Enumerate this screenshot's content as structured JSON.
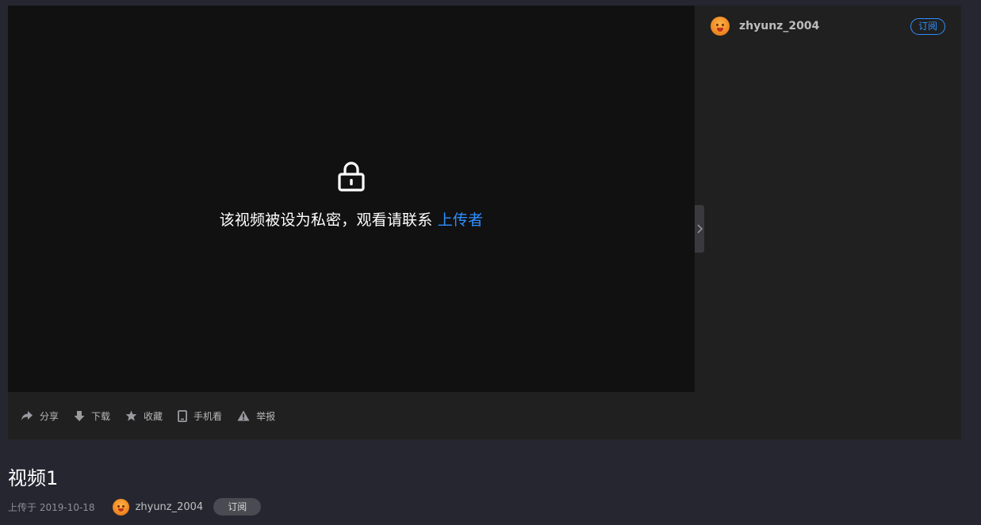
{
  "player": {
    "message": "该视频被设为私密，观看请联系",
    "link_text": "上传者"
  },
  "sidebar": {
    "username": "zhyunz_2004",
    "subscribe_label": "订阅"
  },
  "actions": [
    {
      "label": "分享",
      "icon": "share-icon"
    },
    {
      "label": "下载",
      "icon": "download-icon"
    },
    {
      "label": "收藏",
      "icon": "star-icon"
    },
    {
      "label": "手机看",
      "icon": "mobile-icon"
    },
    {
      "label": "举报",
      "icon": "warning-icon"
    }
  ],
  "video": {
    "title": "视频1",
    "upload_date": "上传于 2019-10-18",
    "username": "zhyunz_2004",
    "subscribe_label": "订阅"
  },
  "colors": {
    "accent": "#2f8fff",
    "page_bg": "#262630",
    "player_bg": "#111112",
    "panel_bg": "#202020"
  }
}
